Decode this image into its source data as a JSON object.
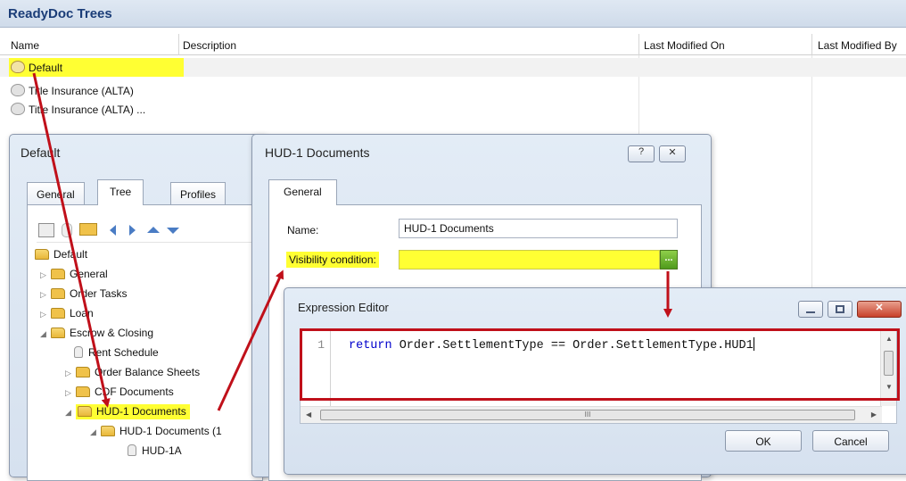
{
  "main": {
    "title": "ReadyDoc Trees",
    "columns": [
      "Name",
      "Description",
      "Last Modified On",
      "Last Modified By"
    ],
    "rows": [
      {
        "name": "Default",
        "selected": true
      },
      {
        "name": "Title Insurance (ALTA)"
      },
      {
        "name": "Title Insurance (ALTA) ..."
      }
    ]
  },
  "default_window": {
    "title": "Default",
    "tabs": [
      "General",
      "Tree",
      "Profiles"
    ],
    "tree": [
      {
        "label": "Default",
        "type": "folder-open",
        "level": 0
      },
      {
        "label": "General",
        "type": "folder",
        "level": 1
      },
      {
        "label": "Order Tasks",
        "type": "folder",
        "level": 1
      },
      {
        "label": "Loan",
        "type": "folder",
        "level": 1
      },
      {
        "label": "Escrow & Closing",
        "type": "folder-open",
        "level": 1
      },
      {
        "label": "Rent Schedule",
        "type": "doc",
        "level": 2
      },
      {
        "label": "Order Balance Sheets",
        "type": "folder",
        "level": 2
      },
      {
        "label": "CDF Documents",
        "type": "folder",
        "level": 2
      },
      {
        "label": "HUD-1 Documents",
        "type": "folder-open",
        "level": 2
      },
      {
        "label": "HUD-1 Documents (1",
        "type": "folder-open",
        "level": 3
      },
      {
        "label": "HUD-1A",
        "type": "doc",
        "level": 4
      }
    ]
  },
  "hud_window": {
    "title": "HUD-1 Documents",
    "help_label": "?",
    "close_label": "✕",
    "tab": "General",
    "name_label": "Name:",
    "name_value": "HUD-1 Documents",
    "visibility_label": "Visibility condition:",
    "visibility_value": "",
    "ellipsis_label": "..."
  },
  "expr_window": {
    "title": "Expression Editor",
    "line_number": "1",
    "code_keyword": "return",
    "code_rest": " Order.SettlementType == Order.SettlementType.HUD1",
    "scroll_mark": "III",
    "ok_label": "OK",
    "cancel_label": "Cancel"
  },
  "colors": {
    "highlight": "#ffff33",
    "arrow": "#c0101a",
    "title_blue": "#1b3d78",
    "keyword": "#0000cc"
  }
}
